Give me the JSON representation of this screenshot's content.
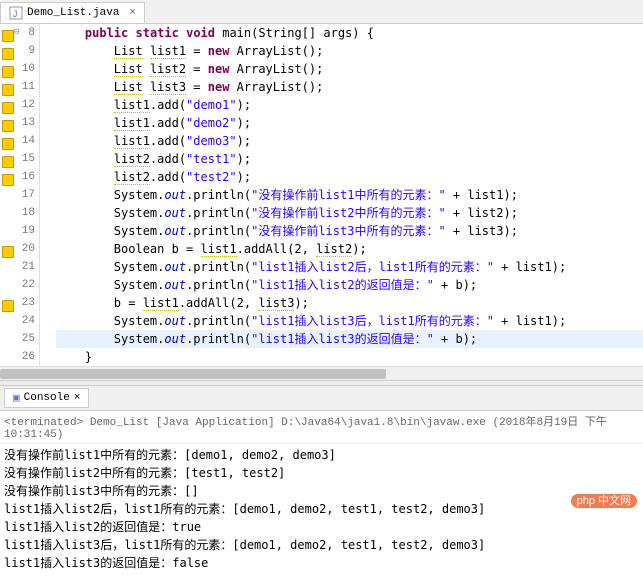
{
  "tab": {
    "filename": "Demo_List.java",
    "close": "×"
  },
  "lines": [
    {
      "n": 8,
      "warn": true,
      "fold": true,
      "tokens": [
        {
          "t": "    ",
          "c": ""
        },
        {
          "t": "public",
          "c": "kw"
        },
        {
          "t": " ",
          "c": ""
        },
        {
          "t": "static",
          "c": "kw"
        },
        {
          "t": " ",
          "c": ""
        },
        {
          "t": "void",
          "c": "kw"
        },
        {
          "t": " main(String[] args) {",
          "c": ""
        }
      ]
    },
    {
      "n": 9,
      "warn": true,
      "tokens": [
        {
          "t": "        ",
          "c": ""
        },
        {
          "t": "List",
          "c": "var-u"
        },
        {
          "t": " ",
          "c": ""
        },
        {
          "t": "list1",
          "c": "var-u"
        },
        {
          "t": " = ",
          "c": ""
        },
        {
          "t": "new",
          "c": "kw"
        },
        {
          "t": " ArrayList();",
          "c": ""
        }
      ]
    },
    {
      "n": 10,
      "warn": true,
      "tokens": [
        {
          "t": "        ",
          "c": ""
        },
        {
          "t": "List",
          "c": "var-u"
        },
        {
          "t": " ",
          "c": ""
        },
        {
          "t": "list2",
          "c": "var-u"
        },
        {
          "t": " = ",
          "c": ""
        },
        {
          "t": "new",
          "c": "kw"
        },
        {
          "t": " ArrayList();",
          "c": ""
        }
      ]
    },
    {
      "n": 11,
      "warn": true,
      "tokens": [
        {
          "t": "        ",
          "c": ""
        },
        {
          "t": "List",
          "c": "var-u"
        },
        {
          "t": " ",
          "c": ""
        },
        {
          "t": "list3",
          "c": "var-u"
        },
        {
          "t": " = ",
          "c": ""
        },
        {
          "t": "new",
          "c": "kw"
        },
        {
          "t": " ArrayList();",
          "c": ""
        }
      ]
    },
    {
      "n": 12,
      "warn": true,
      "tokens": [
        {
          "t": "        ",
          "c": ""
        },
        {
          "t": "list1",
          "c": "var-u"
        },
        {
          "t": ".add(",
          "c": ""
        },
        {
          "t": "\"demo1\"",
          "c": "str"
        },
        {
          "t": ");",
          "c": ""
        }
      ]
    },
    {
      "n": 13,
      "warn": true,
      "tokens": [
        {
          "t": "        ",
          "c": ""
        },
        {
          "t": "list1",
          "c": "var-u"
        },
        {
          "t": ".add(",
          "c": ""
        },
        {
          "t": "\"demo2\"",
          "c": "str"
        },
        {
          "t": ");",
          "c": ""
        }
      ]
    },
    {
      "n": 14,
      "warn": true,
      "tokens": [
        {
          "t": "        ",
          "c": ""
        },
        {
          "t": "list1",
          "c": "var-u"
        },
        {
          "t": ".add(",
          "c": ""
        },
        {
          "t": "\"demo3\"",
          "c": "str"
        },
        {
          "t": ");",
          "c": ""
        }
      ]
    },
    {
      "n": 15,
      "warn": true,
      "tokens": [
        {
          "t": "        ",
          "c": ""
        },
        {
          "t": "list2",
          "c": "var-u"
        },
        {
          "t": ".add(",
          "c": ""
        },
        {
          "t": "\"test1\"",
          "c": "str"
        },
        {
          "t": ");",
          "c": ""
        }
      ]
    },
    {
      "n": 16,
      "warn": true,
      "tokens": [
        {
          "t": "        ",
          "c": ""
        },
        {
          "t": "list2",
          "c": "var-u"
        },
        {
          "t": ".add(",
          "c": ""
        },
        {
          "t": "\"test2\"",
          "c": "str"
        },
        {
          "t": ");",
          "c": ""
        }
      ]
    },
    {
      "n": 17,
      "tokens": [
        {
          "t": "        System.",
          "c": ""
        },
        {
          "t": "out",
          "c": "field"
        },
        {
          "t": ".println(",
          "c": ""
        },
        {
          "t": "\"没有操作前list1中所有的元素：\"",
          "c": "str"
        },
        {
          "t": " + list1);",
          "c": ""
        }
      ]
    },
    {
      "n": 18,
      "tokens": [
        {
          "t": "        System.",
          "c": ""
        },
        {
          "t": "out",
          "c": "field"
        },
        {
          "t": ".println(",
          "c": ""
        },
        {
          "t": "\"没有操作前list2中所有的元素：\"",
          "c": "str"
        },
        {
          "t": " + list2);",
          "c": ""
        }
      ]
    },
    {
      "n": 19,
      "tokens": [
        {
          "t": "        System.",
          "c": ""
        },
        {
          "t": "out",
          "c": "field"
        },
        {
          "t": ".println(",
          "c": ""
        },
        {
          "t": "\"没有操作前list3中所有的元素：\"",
          "c": "str"
        },
        {
          "t": " + list3);",
          "c": ""
        }
      ]
    },
    {
      "n": 20,
      "warn": true,
      "tokens": [
        {
          "t": "        Boolean b = ",
          "c": ""
        },
        {
          "t": "list1",
          "c": "var-u"
        },
        {
          "t": ".addAll(2, ",
          "c": ""
        },
        {
          "t": "list2",
          "c": "var-u"
        },
        {
          "t": ");",
          "c": ""
        }
      ]
    },
    {
      "n": 21,
      "tokens": [
        {
          "t": "        System.",
          "c": ""
        },
        {
          "t": "out",
          "c": "field"
        },
        {
          "t": ".println(",
          "c": ""
        },
        {
          "t": "\"list1插入list2后，list1所有的元素：\"",
          "c": "str"
        },
        {
          "t": " + list1);",
          "c": ""
        }
      ]
    },
    {
      "n": 22,
      "tokens": [
        {
          "t": "        System.",
          "c": ""
        },
        {
          "t": "out",
          "c": "field"
        },
        {
          "t": ".println(",
          "c": ""
        },
        {
          "t": "\"list1插入list2的返回值是：\"",
          "c": "str"
        },
        {
          "t": " + b);",
          "c": ""
        }
      ]
    },
    {
      "n": 23,
      "warn": true,
      "tokens": [
        {
          "t": "        b = ",
          "c": ""
        },
        {
          "t": "list1",
          "c": "var-u"
        },
        {
          "t": ".addAll(2, ",
          "c": ""
        },
        {
          "t": "list3",
          "c": "var-u"
        },
        {
          "t": ");",
          "c": ""
        }
      ]
    },
    {
      "n": 24,
      "tokens": [
        {
          "t": "        System.",
          "c": ""
        },
        {
          "t": "out",
          "c": "field"
        },
        {
          "t": ".println(",
          "c": ""
        },
        {
          "t": "\"list1插入list3后，list1所有的元素：\"",
          "c": "str"
        },
        {
          "t": " + list1);",
          "c": ""
        }
      ]
    },
    {
      "n": 25,
      "hl": true,
      "tokens": [
        {
          "t": "        System.",
          "c": ""
        },
        {
          "t": "out",
          "c": "field"
        },
        {
          "t": ".println(",
          "c": ""
        },
        {
          "t": "\"list1插入list3的返回值是：\"",
          "c": "str"
        },
        {
          "t": " + b);",
          "c": ""
        }
      ]
    },
    {
      "n": 26,
      "tokens": [
        {
          "t": "    }",
          "c": ""
        }
      ]
    }
  ],
  "console": {
    "tab_label": "Console",
    "close": "×",
    "terminated": "<terminated> Demo_List [Java Application] D:\\Java64\\java1.8\\bin\\javaw.exe (2018年8月19日 下午10:31:45)",
    "output": [
      "没有操作前list1中所有的元素：[demo1, demo2, demo3]",
      "没有操作前list2中所有的元素：[test1, test2]",
      "没有操作前list3中所有的元素：[]",
      "list1插入list2后，list1所有的元素：[demo1, demo2, test1, test2, demo3]",
      "list1插入list2的返回值是：true",
      "list1插入list3后，list1所有的元素：[demo1, demo2, test1, test2, demo3]",
      "list1插入list3的返回值是：false"
    ]
  },
  "watermark": "php 中文网"
}
